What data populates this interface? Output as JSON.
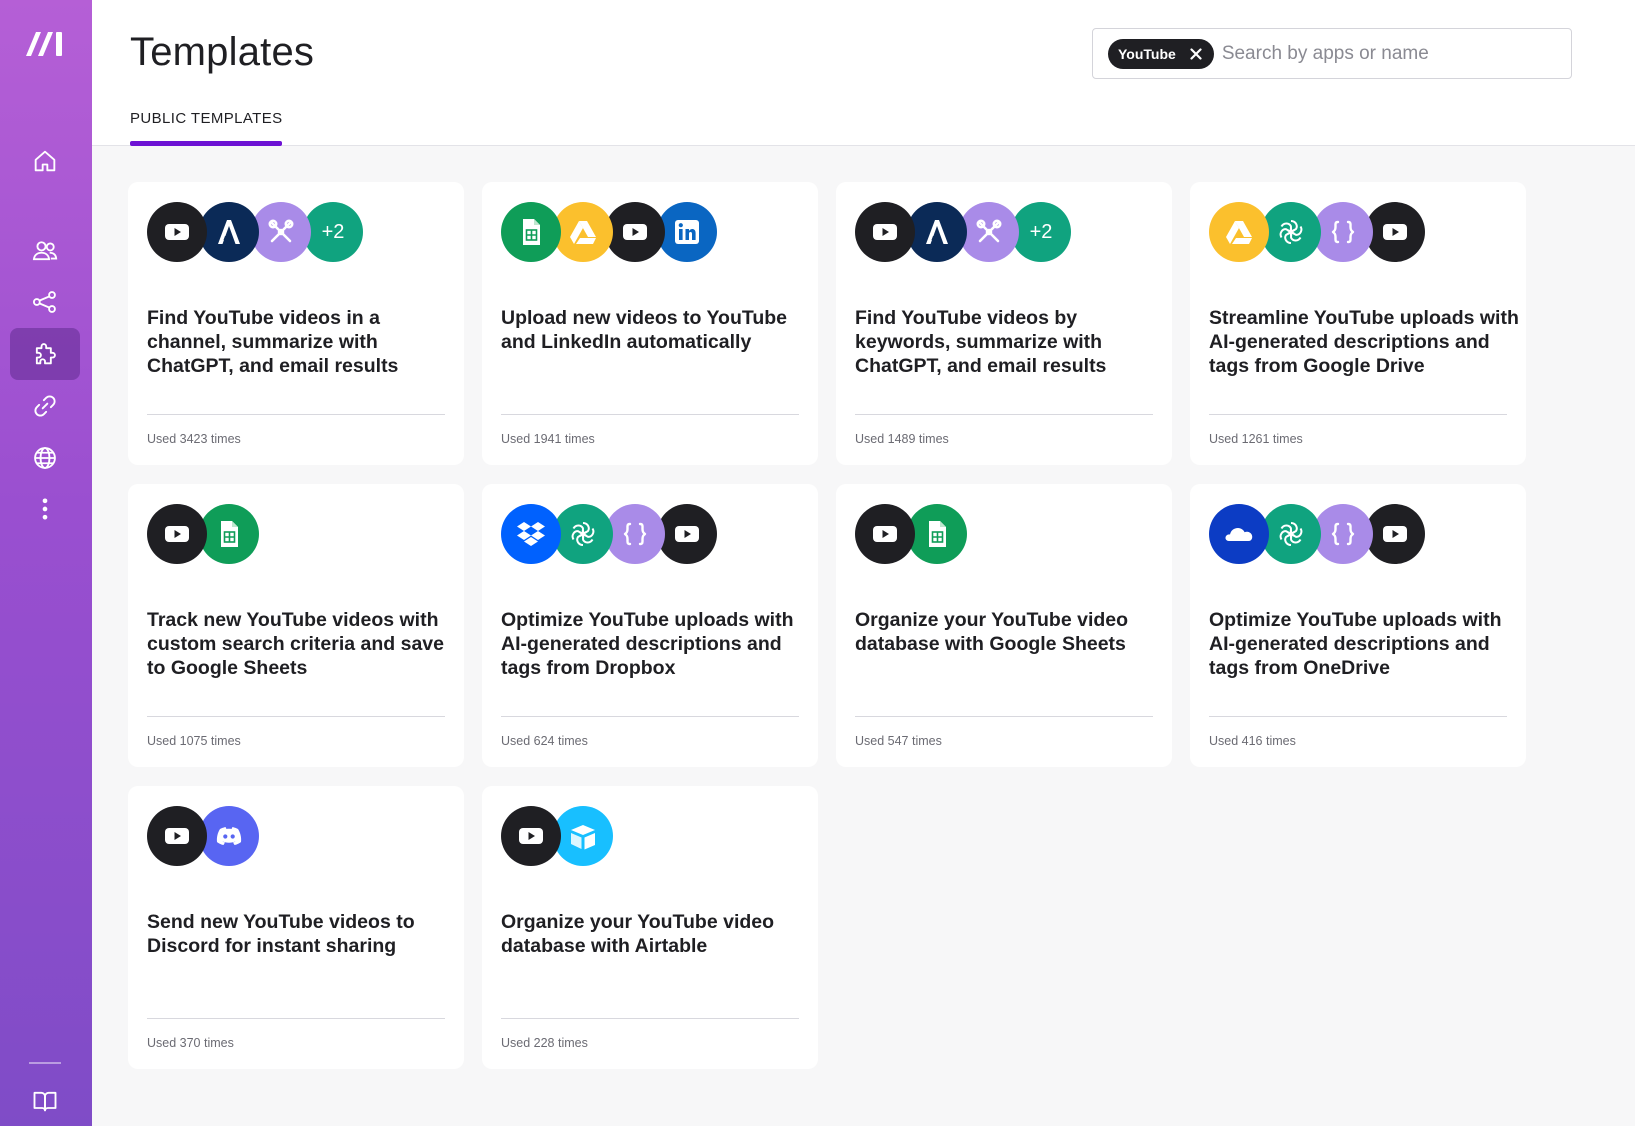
{
  "sidebar": {
    "items": [
      {
        "icon": "home-icon",
        "label": "Home"
      },
      {
        "icon": "team-icon",
        "label": "Team"
      },
      {
        "icon": "scenarios-icon",
        "label": "Scenarios"
      },
      {
        "icon": "templates-icon",
        "label": "Templates",
        "active": true
      },
      {
        "icon": "connections-icon",
        "label": "Connections"
      },
      {
        "icon": "globe-icon",
        "label": "Webhooks"
      },
      {
        "icon": "more-icon",
        "label": "More"
      },
      {
        "icon": "docs-icon",
        "label": "Documentation"
      }
    ]
  },
  "header": {
    "title": "Templates",
    "tab": "PUBLIC TEMPLATES",
    "search": {
      "chip": "YouTube",
      "placeholder": "Search by apps or name"
    }
  },
  "colors": {
    "accent": "#6d12d4",
    "youtube": "#1f1f23",
    "sheets": "#0f9d58",
    "drive": "#fbc02d",
    "linkedin": "#0a66c2",
    "openai": "#10a37f",
    "json": "#a98be8",
    "tools": "#a98be8",
    "anthropic": "#0b2a57",
    "dropbox": "#0061fe",
    "onedrive": "#0c3cc4",
    "discord": "#5865f2",
    "airtable": "#18bfff"
  },
  "templates": [
    {
      "title": "Find YouTube videos in a channel, summarize with ChatGPT, and email results",
      "usage": "Used 3423 times",
      "apps": [
        "youtube",
        "anthropic",
        "tools"
      ],
      "extra": "+2"
    },
    {
      "title": "Upload new videos to YouTube and LinkedIn automatically",
      "usage": "Used 1941 times",
      "apps": [
        "sheets",
        "drive",
        "youtube",
        "linkedin"
      ],
      "extra": ""
    },
    {
      "title": "Find YouTube videos by keywords, summarize with ChatGPT, and email results",
      "usage": "Used 1489 times",
      "apps": [
        "youtube",
        "anthropic",
        "tools"
      ],
      "extra": "+2"
    },
    {
      "title": "Streamline YouTube uploads with AI-generated descriptions and tags from Google Drive",
      "usage": "Used 1261 times",
      "apps": [
        "drive",
        "openai",
        "json",
        "youtube"
      ],
      "extra": ""
    },
    {
      "title": "Track new YouTube videos with custom search criteria and save to Google Sheets",
      "usage": "Used 1075 times",
      "apps": [
        "youtube",
        "sheets"
      ],
      "extra": ""
    },
    {
      "title": "Optimize YouTube uploads with AI-generated descriptions and tags from Dropbox",
      "usage": "Used 624 times",
      "apps": [
        "dropbox",
        "openai",
        "json",
        "youtube"
      ],
      "extra": ""
    },
    {
      "title": "Organize your YouTube video database with Google Sheets",
      "usage": "Used 547 times",
      "apps": [
        "youtube",
        "sheets"
      ],
      "extra": ""
    },
    {
      "title": "Optimize YouTube uploads with AI-generated descriptions and tags from OneDrive",
      "usage": "Used 416 times",
      "apps": [
        "onedrive",
        "openai",
        "json",
        "youtube"
      ],
      "extra": ""
    },
    {
      "title": "Send new YouTube videos to Discord for instant sharing",
      "usage": "Used 370 times",
      "apps": [
        "youtube",
        "discord"
      ],
      "extra": ""
    },
    {
      "title": "Organize your YouTube video database with Airtable",
      "usage": "Used 228 times",
      "apps": [
        "youtube",
        "airtable"
      ],
      "extra": ""
    }
  ]
}
